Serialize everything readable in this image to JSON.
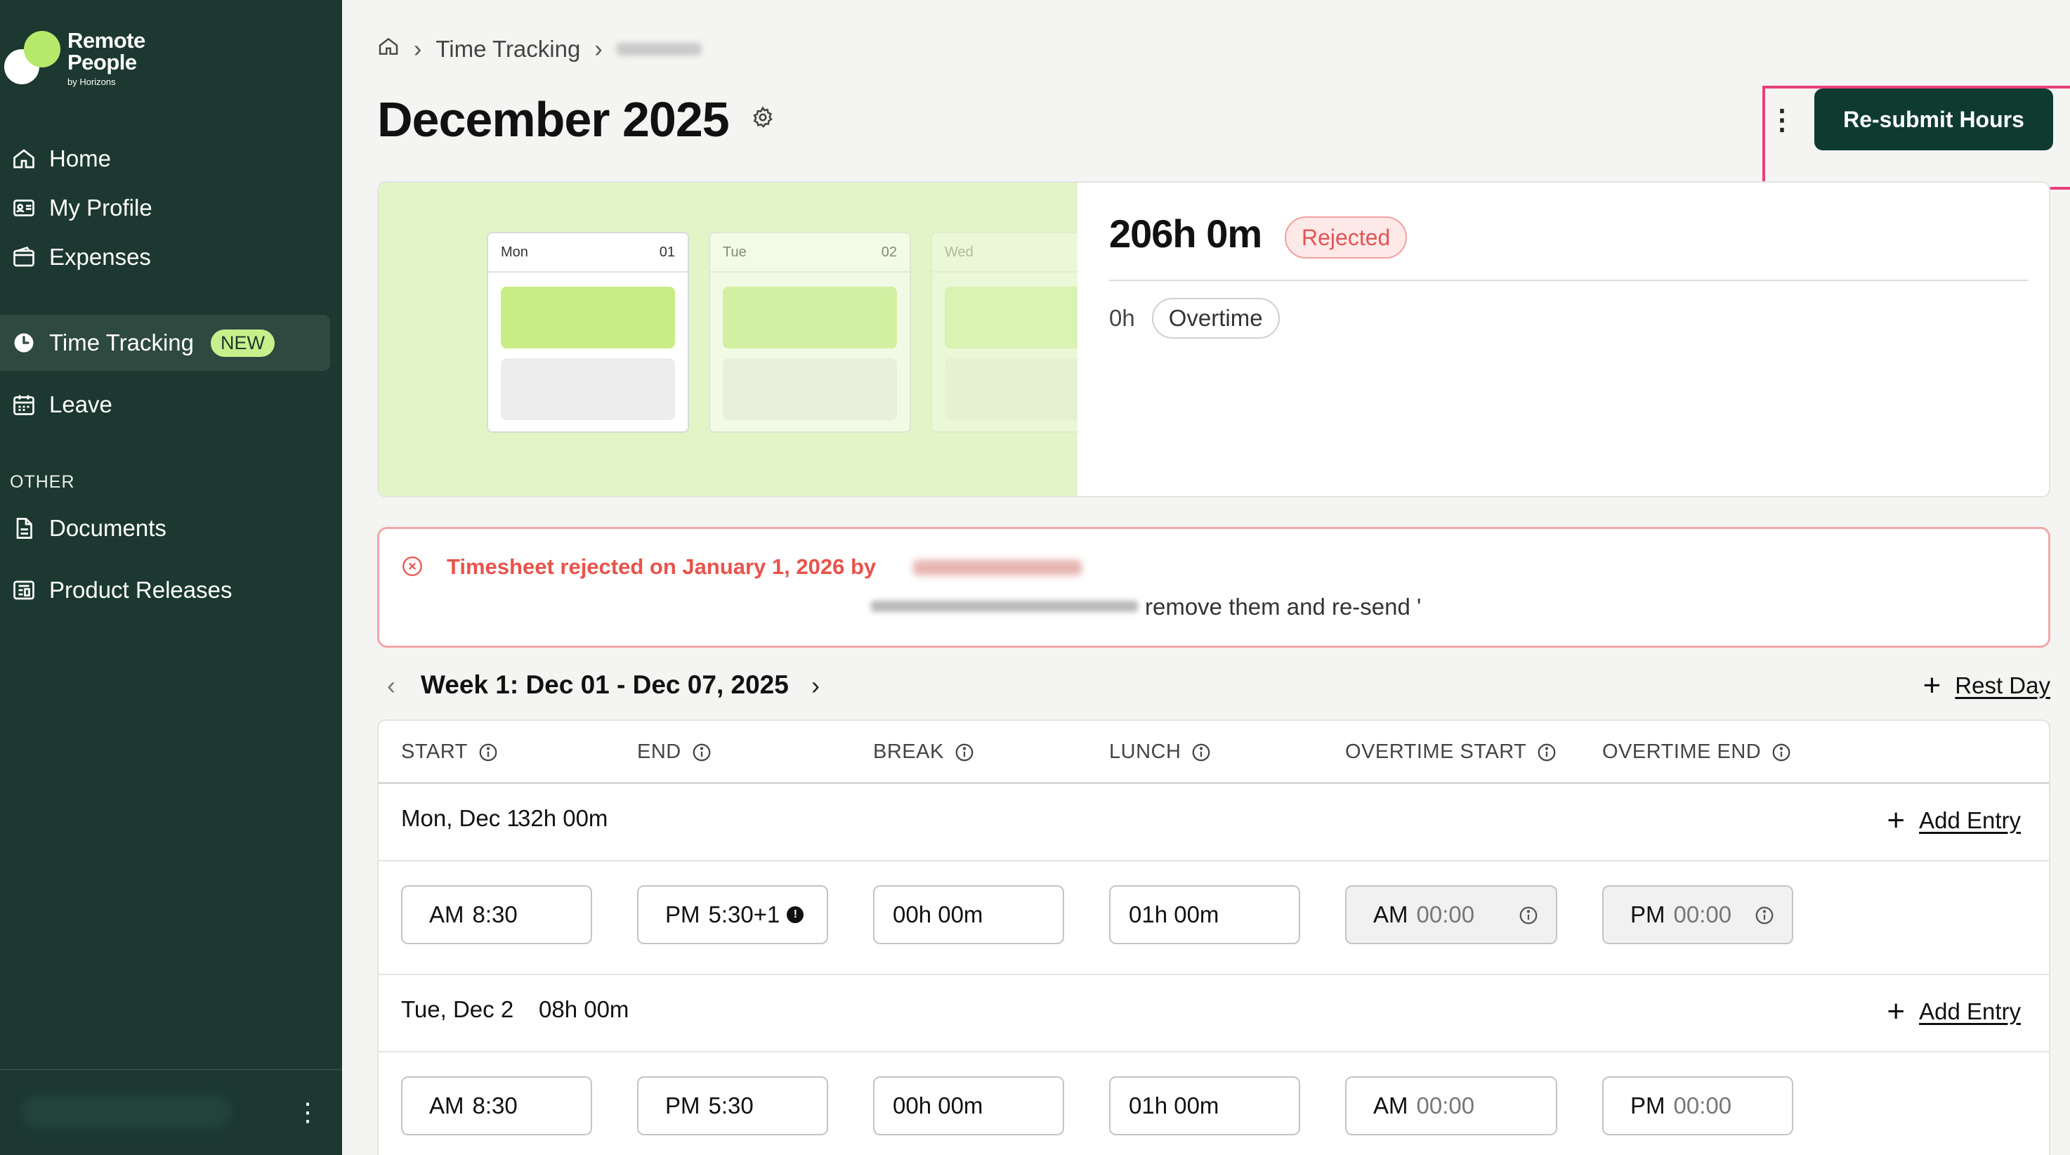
{
  "brand": {
    "line1": "Remote",
    "line2": "People",
    "tagline": "by Horizons"
  },
  "nav": {
    "items": [
      {
        "label": "Home",
        "icon": "home-icon"
      },
      {
        "label": "My Profile",
        "icon": "id-card-icon"
      },
      {
        "label": "Expenses",
        "icon": "wallet-icon"
      },
      {
        "label": "Time Tracking",
        "icon": "clock-icon",
        "badge": "NEW",
        "active": true
      },
      {
        "label": "Leave",
        "icon": "calendar-icon"
      }
    ],
    "other_label": "OTHER",
    "other_items": [
      {
        "label": "Documents",
        "icon": "document-icon"
      },
      {
        "label": "Product Releases",
        "icon": "releases-icon"
      }
    ]
  },
  "breadcrumb": {
    "section": "Time Tracking"
  },
  "page": {
    "title": "December 2025",
    "resubmit_label": "Re-submit Hours"
  },
  "summary": {
    "preview_days": [
      {
        "day": "Mon",
        "num": "01"
      },
      {
        "day": "Tue",
        "num": "02"
      },
      {
        "day": "Wed",
        "num": ""
      }
    ],
    "total_hours": "206h 0m",
    "status": "Rejected",
    "overtime_value": "0h",
    "overtime_label": "Overtime"
  },
  "alert": {
    "title": "Timesheet rejected on January 1, 2026 by",
    "message": "remove them and re-send '"
  },
  "week": {
    "title": "Week 1: Dec 01 - Dec 07, 2025",
    "rest_day_label": "Rest Day"
  },
  "table": {
    "columns": [
      "START",
      "END",
      "BREAK",
      "LUNCH",
      "OVERTIME START",
      "OVERTIME END"
    ],
    "add_entry_label": "Add Entry",
    "days": [
      {
        "label": "Mon, Dec 1",
        "total": "32h 00m",
        "start_ampm": "AM",
        "start": "8:30",
        "end_ampm": "PM",
        "end": "5:30+1",
        "break": "00h 00m",
        "lunch": "01h 00m",
        "ot_start_ampm": "AM",
        "ot_start": "00:00",
        "ot_end_ampm": "PM",
        "ot_end": "00:00"
      },
      {
        "label": "Tue, Dec 2",
        "total": "08h 00m",
        "start_ampm": "AM",
        "start": "8:30",
        "end_ampm": "PM",
        "end": "5:30",
        "break": "00h 00m",
        "lunch": "01h 00m",
        "ot_start_ampm": "AM",
        "ot_start": "00:00",
        "ot_end_ampm": "PM",
        "ot_end": "00:00"
      }
    ]
  },
  "colors": {
    "sidebar_bg": "#1c3830",
    "accent_green": "#c8f08a",
    "primary_button": "#0f3a30",
    "rejected_red": "#e8534c",
    "highlight_pink": "#e9407a"
  }
}
